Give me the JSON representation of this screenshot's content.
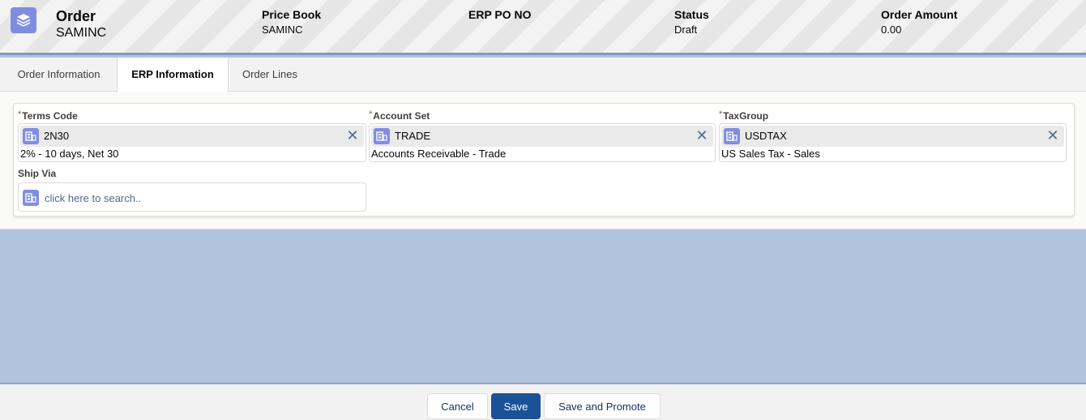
{
  "header": {
    "object_label": "Order",
    "record_name": "SAMINC",
    "fields": [
      {
        "label": "Price Book",
        "value": "SAMINC"
      },
      {
        "label": "ERP PO NO",
        "value": ""
      },
      {
        "label": "Status",
        "value": "Draft"
      },
      {
        "label": "Order Amount",
        "value": "0.00"
      }
    ],
    "icon": "layers-icon"
  },
  "tabs": [
    {
      "label": "Order Information",
      "active": false
    },
    {
      "label": "ERP Information",
      "active": true
    },
    {
      "label": "Order Lines",
      "active": false
    }
  ],
  "form": {
    "required_marker": "*",
    "terms_code": {
      "label": "Terms Code",
      "value": "2N30",
      "description": "2% - 10 days, Net 30",
      "required": true
    },
    "account_set": {
      "label": "Account Set",
      "value": "TRADE",
      "description": "Accounts Receivable - Trade",
      "required": true
    },
    "tax_group": {
      "label": "TaxGroup",
      "value": "USDTAX",
      "description": "US Sales Tax - Sales",
      "required": true
    },
    "ship_via": {
      "label": "Ship Via",
      "value": "",
      "placeholder": "click here to search..",
      "required": false
    }
  },
  "footer": {
    "cancel_label": "Cancel",
    "save_label": "Save",
    "save_promote_label": "Save and Promote"
  },
  "colors": {
    "brand": "#1b5297",
    "icon_bg": "#7f8de1",
    "background": "#b0c4df",
    "required": "#c23934"
  }
}
